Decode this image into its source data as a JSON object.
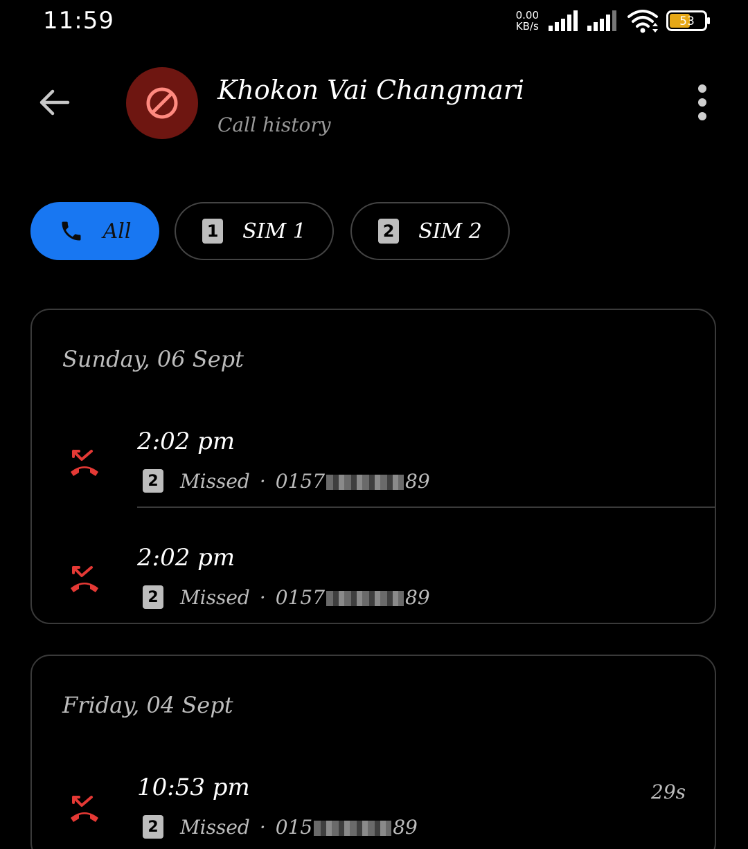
{
  "status_bar": {
    "time": "11:59",
    "speed_value": "0.00",
    "speed_unit": "KB/s",
    "battery_level": "53",
    "icons": [
      "signal-sim1-icon",
      "signal-sim2-icon",
      "wifi-icon",
      "battery-icon"
    ]
  },
  "header": {
    "name": "Khokon Vai Changmari",
    "subtitle": "Call history",
    "avatar_icon": "blocked-icon",
    "colors": {
      "avatar_bg": "#6e1611",
      "avatar_icon": "#ff8a80"
    }
  },
  "filters": {
    "all_label": "All",
    "sim1_label": "SIM 1",
    "sim1_badge": "1",
    "sim2_label": "SIM 2",
    "sim2_badge": "2",
    "active": "All",
    "colors": {
      "active_bg": "#1877f2"
    }
  },
  "groups": [
    {
      "date": "Sunday, 06 Sept",
      "calls": [
        {
          "time": "2:02 pm",
          "sim": "2",
          "type": "Missed",
          "separator": "·",
          "number_prefix": "0157",
          "number_suffix": "89",
          "duration": ""
        },
        {
          "time": "2:02 pm",
          "sim": "2",
          "type": "Missed",
          "separator": "·",
          "number_prefix": "0157",
          "number_suffix": "89",
          "duration": ""
        }
      ]
    },
    {
      "date": "Friday, 04 Sept",
      "calls": [
        {
          "time": "10:53 pm",
          "sim": "2",
          "type": "Missed",
          "separator": "·",
          "number_prefix": "015",
          "number_suffix": "89",
          "duration": "29s"
        }
      ]
    }
  ],
  "missed_color": "#e53935"
}
